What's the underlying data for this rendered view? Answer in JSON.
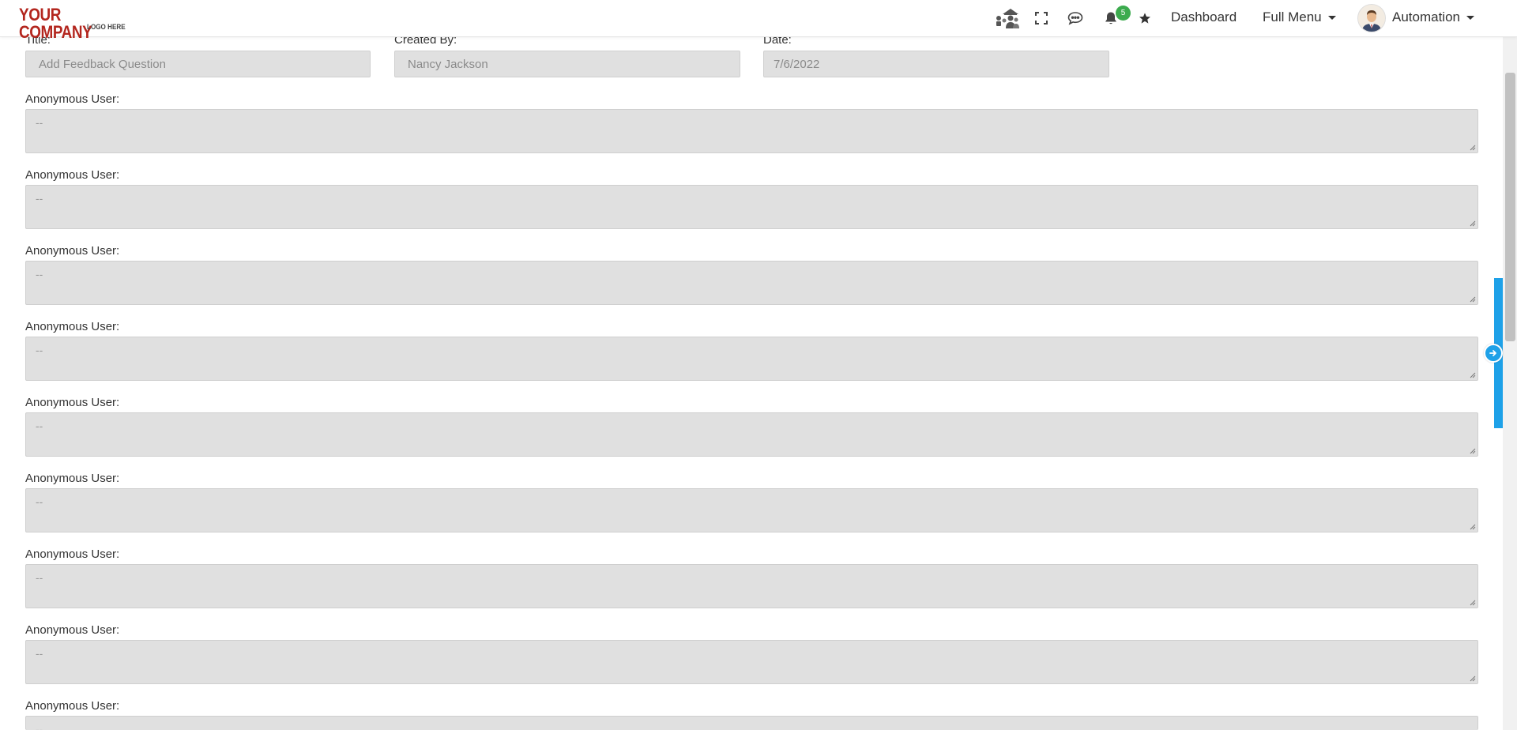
{
  "navbar": {
    "logo_main": "YOUR COMPANY",
    "logo_sub": "LOGO HERE",
    "notification_count": "5",
    "dashboard_label": "Dashboard",
    "full_menu_label": "Full Menu",
    "user_label": "Automation",
    "icons": [
      "org-chart-icon",
      "fullscreen-icon",
      "chat-icon",
      "bell-icon",
      "star-icon"
    ]
  },
  "form": {
    "title_label": "Title:",
    "title_value": "Add Feedback Question",
    "created_by_label": "Created By:",
    "created_by_value": "Nancy Jackson",
    "date_label": "Date:",
    "date_value": "7/6/2022",
    "responses": [
      {
        "label": "Anonymous User:",
        "value": "--"
      },
      {
        "label": "Anonymous User:",
        "value": "--"
      },
      {
        "label": "Anonymous User:",
        "value": "--"
      },
      {
        "label": "Anonymous User:",
        "value": "--"
      },
      {
        "label": "Anonymous User:",
        "value": "--"
      },
      {
        "label": "Anonymous User:",
        "value": "--"
      },
      {
        "label": "Anonymous User:",
        "value": "--"
      },
      {
        "label": "Anonymous User:",
        "value": "--"
      },
      {
        "label": "Anonymous User:",
        "value": "--"
      }
    ]
  },
  "colors": {
    "logo_red": "#b3261e",
    "badge_green": "#3cab4e",
    "side_tab_blue": "#1ea1e8",
    "field_gray": "#e0e0e0"
  }
}
